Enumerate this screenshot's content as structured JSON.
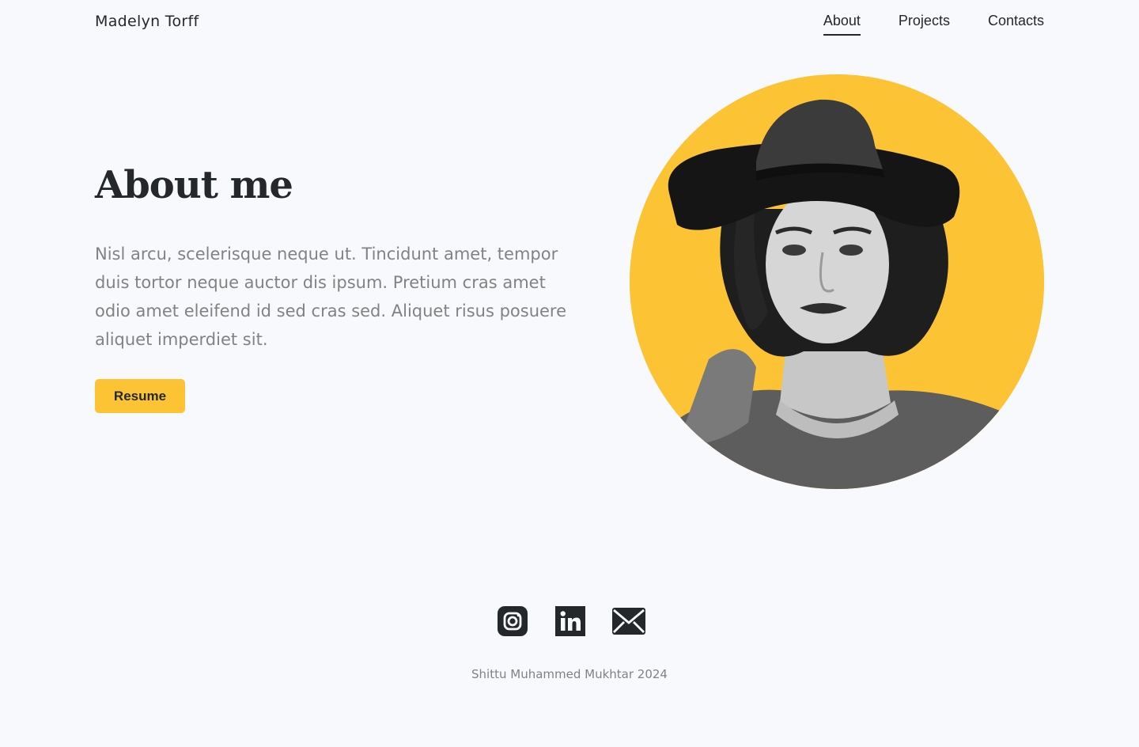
{
  "header": {
    "brand": "Madelyn Torff",
    "nav": [
      {
        "label": "About",
        "active": true
      },
      {
        "label": "Projects",
        "active": false
      },
      {
        "label": "Contacts",
        "active": false
      }
    ]
  },
  "hero": {
    "title": "About me",
    "description": "Nisl arcu, scelerisque neque ut. Tincidunt amet, tempor duis tortor neque auctor dis ipsum. Pretium cras amet odio amet eleifend id sed cras sed. Aliquet risus posuere aliquet imperdiet sit.",
    "resume_label": "Resume",
    "portrait_icon": "woman-with-hat-photo"
  },
  "footer": {
    "socials": [
      {
        "icon": "instagram-icon"
      },
      {
        "icon": "linkedin-icon"
      },
      {
        "icon": "mail-icon"
      }
    ],
    "credit": "Shittu Muhammed Mukhtar 2024"
  },
  "colors": {
    "accent": "#fcc434",
    "background": "#f8f9fd",
    "text": "#25282b",
    "muted": "#828282"
  }
}
